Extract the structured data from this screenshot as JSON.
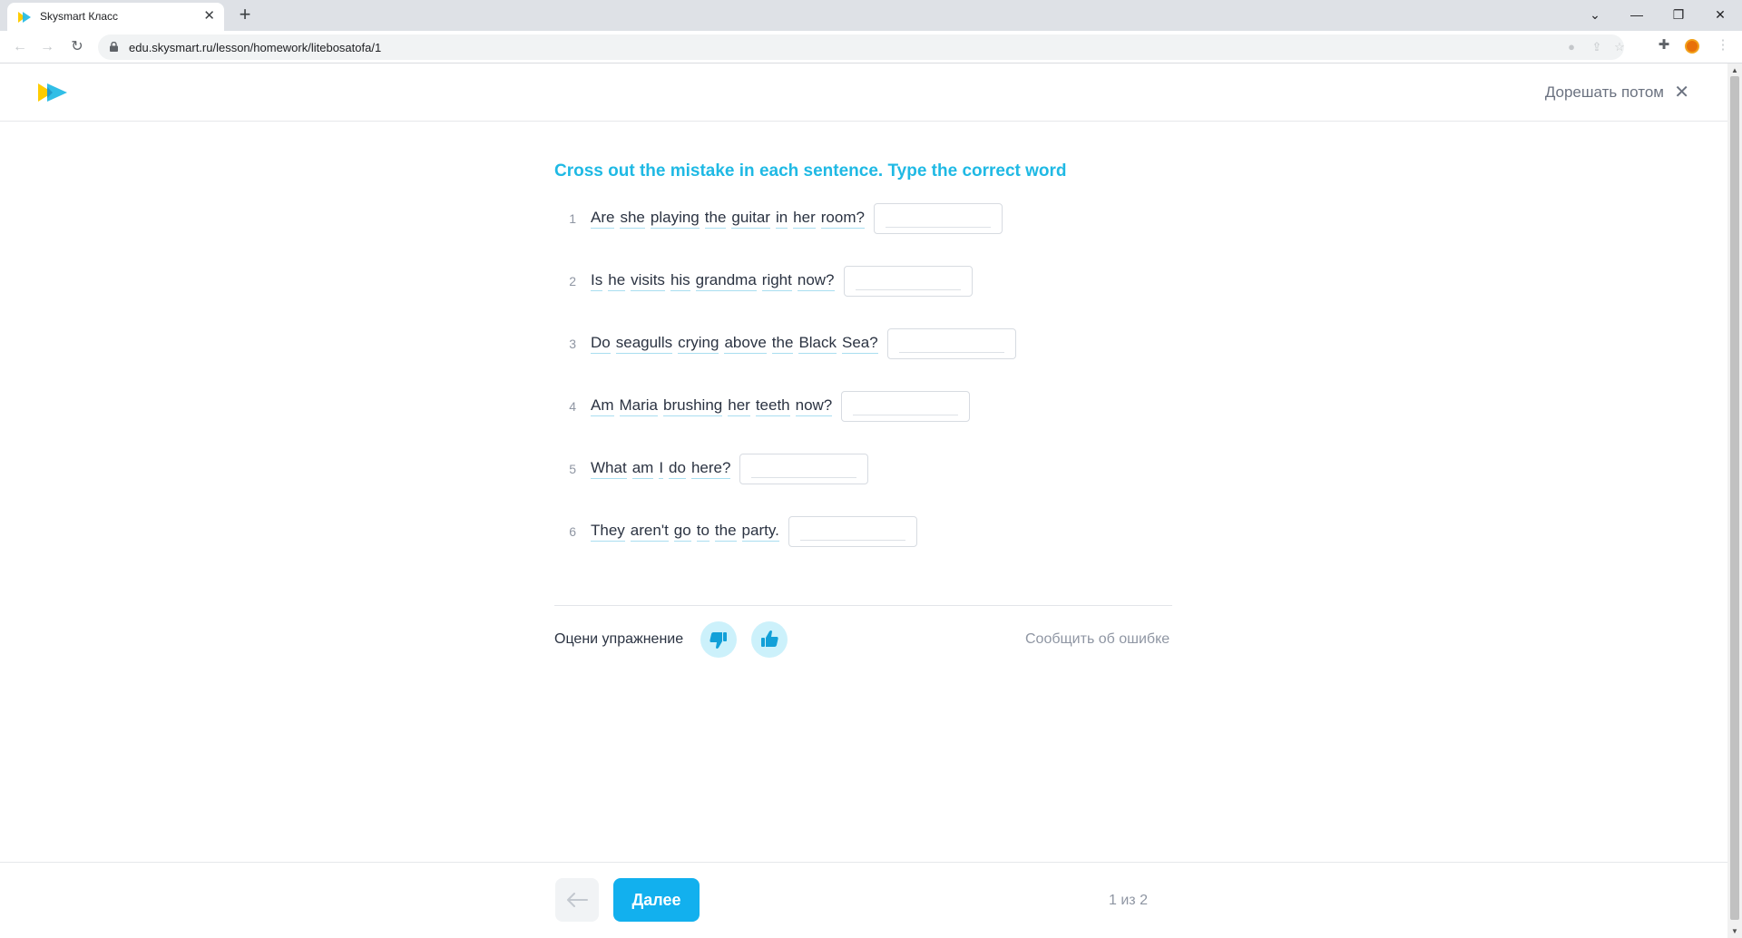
{
  "browser": {
    "tab_title": "Skysmart Класс",
    "tab_close": "✕",
    "new_tab": "+",
    "url": "edu.skysmart.ru/lesson/homework/litebosatofa/1",
    "window_controls": {
      "dropdown": "⌄",
      "minimize": "—",
      "restore": "❐",
      "close": "✕"
    },
    "nav": {
      "back": "←",
      "forward": "→",
      "reload": "↻"
    }
  },
  "header": {
    "solve_later": "Дорешать потом",
    "close": "✕"
  },
  "task": {
    "title": "Cross out the mistake in each sentence. Type the correct word",
    "questions": [
      {
        "num": "1",
        "words": [
          "Are",
          "she",
          "playing",
          "the",
          "guitar",
          "in",
          "her",
          "room?"
        ],
        "answer": ""
      },
      {
        "num": "2",
        "words": [
          "Is",
          "he",
          "visits",
          "his",
          "grandma",
          "right",
          "now?"
        ],
        "answer": ""
      },
      {
        "num": "3",
        "words": [
          "Do",
          "seagulls",
          "crying",
          "above",
          "the",
          "Black",
          "Sea?"
        ],
        "answer": ""
      },
      {
        "num": "4",
        "words": [
          "Am",
          "Maria",
          "brushing",
          "her",
          "teeth",
          "now?"
        ],
        "answer": ""
      },
      {
        "num": "5",
        "words": [
          "What",
          "am",
          "I",
          "do",
          "here?"
        ],
        "answer": ""
      },
      {
        "num": "6",
        "words": [
          "They",
          "aren't",
          "go",
          "to",
          "the",
          "party."
        ],
        "answer": ""
      }
    ]
  },
  "rating": {
    "label": "Оцени упражнение",
    "report": "Сообщить об ошибке"
  },
  "footer": {
    "next_label": "Далее",
    "pager": "1 из 2"
  },
  "colors": {
    "accent": "#1fb9e4",
    "button": "#12b0ee",
    "logo_yellow": "#ffcc00",
    "logo_blue": "#1fb9e4"
  }
}
